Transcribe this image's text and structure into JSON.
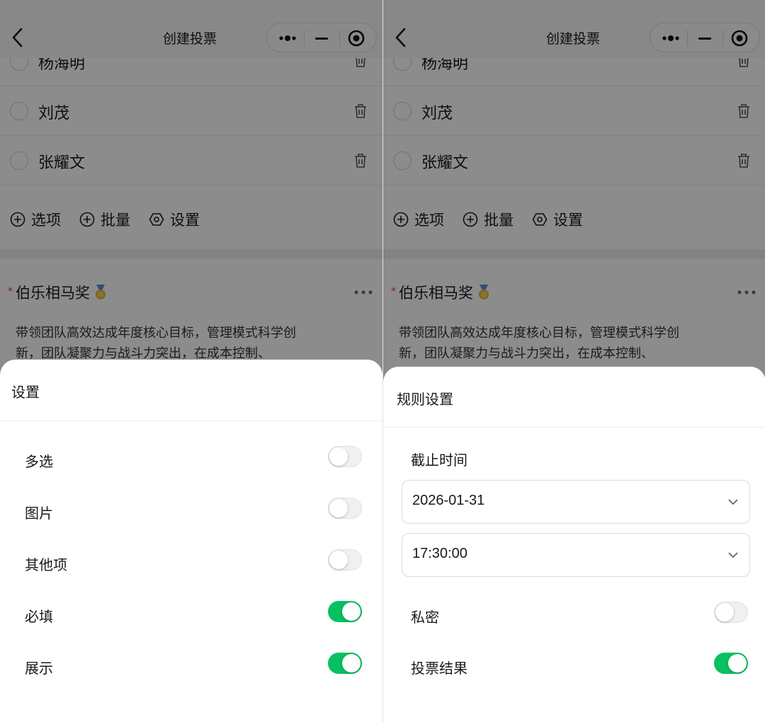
{
  "nav": {
    "title": "创建投票"
  },
  "background": {
    "options": [
      {
        "label": "杨海明"
      },
      {
        "label": "刘茂"
      },
      {
        "label": "张耀文"
      }
    ],
    "toolbar": {
      "add_option": "选项",
      "batch": "批量",
      "settings": "设置"
    },
    "question": {
      "title": "伯乐相马奖",
      "description": "带领团队高效达成年度核心目标，管理模式科学创新，团队凝聚力与战斗力突出，在成本控制、"
    }
  },
  "left_sheet": {
    "title": "设置",
    "settings": [
      {
        "label": "多选",
        "on": false
      },
      {
        "label": "图片",
        "on": false
      },
      {
        "label": "其他项",
        "on": false
      },
      {
        "label": "必填",
        "on": true
      },
      {
        "label": "展示",
        "on": true
      }
    ]
  },
  "right_sheet": {
    "title": "规则设置",
    "deadline_label": "截止时间",
    "date_value": "2026-01-31",
    "time_value": "17:30:00",
    "settings": [
      {
        "label": "私密",
        "on": false
      },
      {
        "label": "投票结果",
        "on": true
      }
    ]
  },
  "colors": {
    "accent_green": "#07c160",
    "required_red": "#e53935",
    "mask": "rgba(0,0,0,0.45)"
  },
  "icons": [
    "back-arrow-icon",
    "more-dots-icon",
    "minimize-icon",
    "close-target-icon",
    "trash-icon",
    "plus-circle-icon",
    "gear-icon",
    "medal-icon",
    "ellipsis-icon",
    "chevron-down-icon"
  ]
}
